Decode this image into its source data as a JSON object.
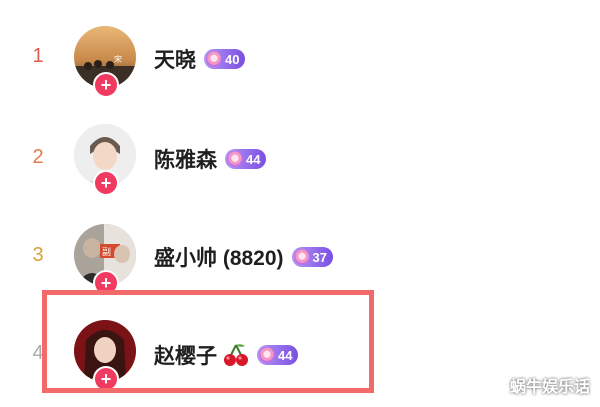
{
  "ranking": {
    "items": [
      {
        "rank": "1",
        "rank_color": "#e0594b",
        "name": "天晓",
        "level": "40",
        "emoji": "",
        "avatar": "photo-concert"
      },
      {
        "rank": "2",
        "rank_color": "#e57a4c",
        "name": "陈雅森",
        "level": "44",
        "emoji": "",
        "avatar": "photo-man"
      },
      {
        "rank": "3",
        "rank_color": "#d4a33a",
        "name": "盛小帅 (8820)",
        "level": "37",
        "emoji": "",
        "avatar": "photo-group"
      },
      {
        "rank": "4",
        "rank_color": "#aaaaaa",
        "name": "赵樱子",
        "level": "44",
        "emoji": "cherry-icon",
        "avatar": "photo-woman"
      }
    ]
  },
  "watermark": "蜗牛娱乐话",
  "colors": {
    "highlight": "#f26a6a",
    "follow": "#f03a5f",
    "badge": "#8b5cf0"
  }
}
